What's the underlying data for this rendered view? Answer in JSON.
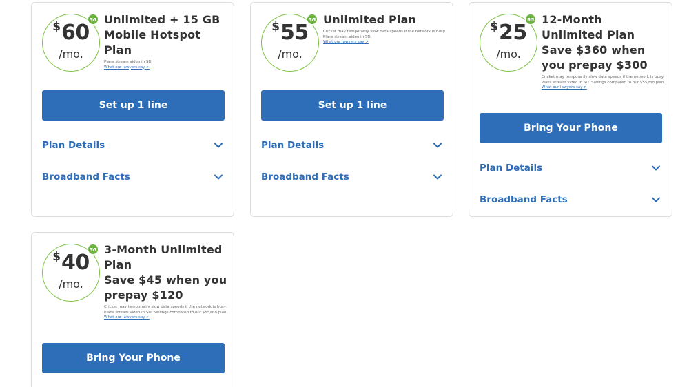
{
  "badge_label": "5G",
  "colors": {
    "accent": "#2e6eb8",
    "badge": "#6db33f",
    "ring": "#7cc242"
  },
  "icons": {
    "badge": "5g-badge-icon",
    "accordion": "chevron-down-icon"
  },
  "plans": [
    {
      "currency": "$",
      "price": "60",
      "per": "/mo.",
      "title": "Unlimited + 15 GB Mobile Hotspot Plan",
      "savings": "",
      "disclaimer": "Plans stream video in SD.",
      "link": "What our lawyers say >",
      "cta": "Set up 1 line",
      "details": "Plan Details",
      "facts": "Broadband Facts"
    },
    {
      "currency": "$",
      "price": "55",
      "per": "/mo.",
      "title": "Unlimited Plan",
      "savings": "",
      "disclaimer": "Cricket may temporarily slow data speeds if the network is busy. Plans stream video in SD.",
      "link": "What our lawyers say >",
      "cta": "Set up 1 line",
      "details": "Plan Details",
      "facts": "Broadband Facts"
    },
    {
      "currency": "$",
      "price": "25",
      "per": "/mo.",
      "title": "12-Month Unlimited Plan",
      "savings": "Save $360 when you prepay $300",
      "disclaimer": "Cricket may temporarily slow data speeds if the network is busy. Plans stream video in SD. Savings compared to our $55/mo plan.",
      "link": "What our lawyers say >",
      "cta": "Bring Your Phone",
      "details": "Plan Details",
      "facts": "Broadband Facts"
    },
    {
      "currency": "$",
      "price": "40",
      "per": "/mo.",
      "title": "3-Month Unlimited Plan",
      "savings": "Save $45 when you prepay $120",
      "disclaimer": "Cricket may temporarily slow data speeds if the network is busy. Plans stream video in SD. Savings compared to our $55/mo plan.",
      "link": "What our lawyers say >",
      "cta": "Bring Your Phone"
    }
  ]
}
